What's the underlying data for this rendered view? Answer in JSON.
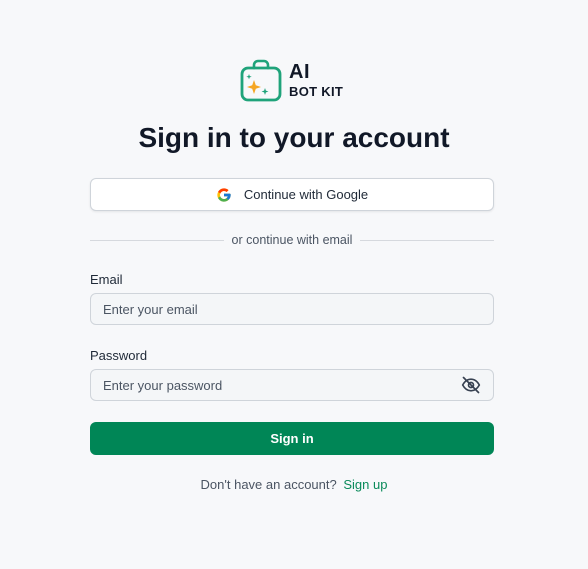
{
  "brand": {
    "line1": "AI",
    "line2": "BOT KIT",
    "accent_color": "#1fa37a",
    "sparkle_color": "#f5a623",
    "logo_icon": "shopping-bag-sparkle-icon"
  },
  "header": {
    "title": "Sign in to your account"
  },
  "oauth": {
    "google_label": "Continue with Google",
    "google_icon": "google-icon"
  },
  "divider": {
    "text": "or continue with email"
  },
  "form": {
    "email_label": "Email",
    "email_placeholder": "Enter your email",
    "email_value": "",
    "password_label": "Password",
    "password_placeholder": "Enter your password",
    "password_value": "",
    "password_toggle_icon": "eye-off-icon",
    "submit_label": "Sign in",
    "submit_color": "#008656"
  },
  "footer": {
    "prompt": "Don't have an account?",
    "link_label": "Sign up",
    "link_color": "#0a8a5a"
  }
}
